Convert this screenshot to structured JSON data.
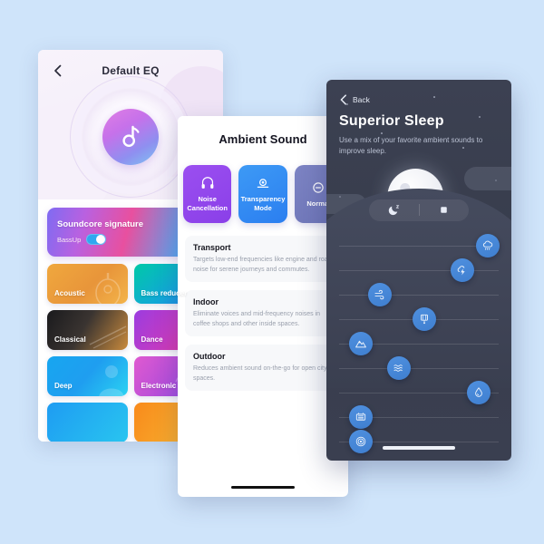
{
  "background_color": "#cfe4fa",
  "eq_screen": {
    "back_icon": "chevron-left-icon",
    "title": "Default EQ",
    "hero_icon": "soundcore-logo-icon",
    "signature_preset": {
      "label": "Soundcore signature",
      "bassup_label": "BassUp",
      "bassup_on": true,
      "selected": true,
      "check_icon": "check-circle-icon"
    },
    "presets": [
      {
        "label": "Acoustic",
        "art": "guitar-icon"
      },
      {
        "label": "Bass reducer",
        "art": "speaker-icon"
      },
      {
        "label": "Classical",
        "art": "piano-icon"
      },
      {
        "label": "Dance",
        "art": "disc-icon"
      },
      {
        "label": "Deep",
        "art": "person-icon"
      },
      {
        "label": "Electronic",
        "art": "waveform-icon"
      },
      {
        "label": "",
        "art": "none"
      },
      {
        "label": "",
        "art": "none"
      }
    ]
  },
  "ambient_screen": {
    "title": "Ambient Sound",
    "modes": [
      {
        "label": "Noise Cancellation",
        "icon": "noise-cancel-icon"
      },
      {
        "label": "Transparency Mode",
        "icon": "transparency-icon"
      },
      {
        "label": "Normal",
        "icon": "normal-mode-icon"
      }
    ],
    "sections": [
      {
        "heading": "Transport",
        "body": "Targets low-end frequencies like engine and road noise for serene journeys and commutes."
      },
      {
        "heading": "Indoor",
        "body": "Eliminate voices and mid-frequency noises in coffee shops and other inside spaces."
      },
      {
        "heading": "Outdoor",
        "body": "Reduces ambient sound on-the-go for open city spaces."
      }
    ]
  },
  "sleep_screen": {
    "back_label": "Back",
    "back_icon": "chevron-left-icon",
    "title": "Superior Sleep",
    "subtitle": "Use a mix of your favorite ambient sounds to improve sleep.",
    "toggle": {
      "left_icon": "moon-sleep-icon",
      "right_icon": "stop-square-icon",
      "selected": "left"
    },
    "sound_sliders": [
      {
        "icon": "rain-cloud-icon",
        "value": 86
      },
      {
        "icon": "thunder-icon",
        "value": 70
      },
      {
        "icon": "wind-icon",
        "value": 18
      },
      {
        "icon": "wind-chime-icon",
        "value": 46
      },
      {
        "icon": "mountain-icon",
        "value": 6
      },
      {
        "icon": "waves-icon",
        "value": 30
      },
      {
        "icon": "water-drop-icon",
        "value": 80
      },
      {
        "icon": "fan-icon",
        "value": 6
      },
      {
        "icon": "fingerprint-icon",
        "value": 6
      }
    ]
  }
}
